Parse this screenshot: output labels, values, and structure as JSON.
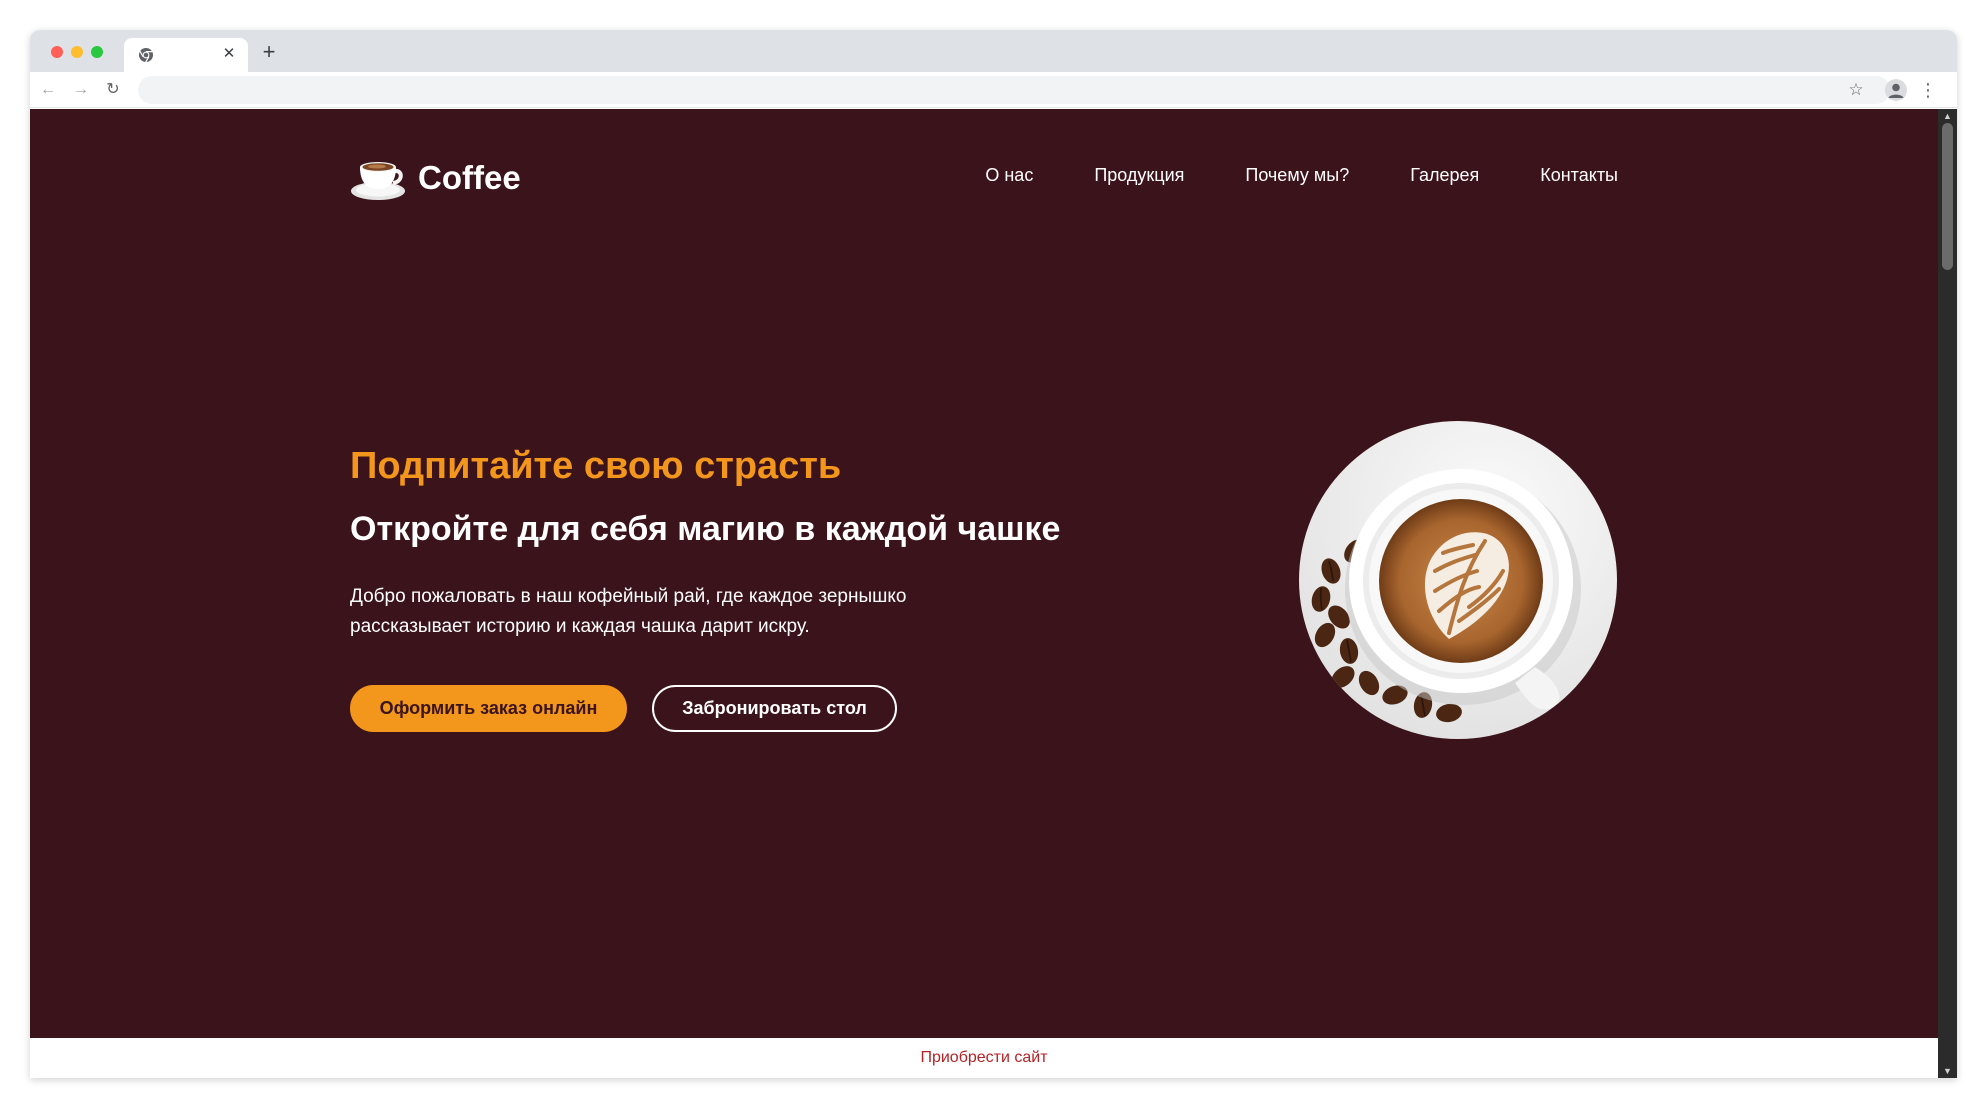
{
  "browser": {
    "tab_title": "",
    "tab_close_glyph": "✕",
    "new_tab_glyph": "+",
    "back_glyph": "←",
    "forward_glyph": "→",
    "reload_glyph": "↻",
    "address_value": "",
    "star_glyph": "☆",
    "menu_glyph": "⋮"
  },
  "header": {
    "logo_text": "Coffee",
    "nav": [
      {
        "label": "О нас"
      },
      {
        "label": "Продукция"
      },
      {
        "label": "Почему мы?"
      },
      {
        "label": "Галерея"
      },
      {
        "label": "Контакты"
      }
    ]
  },
  "hero": {
    "subtitle": "Подпитайте свою страсть",
    "title": "Откройте для себя магию в каждой чашке",
    "description": "Добро пожаловать в наш кофейный рай, где каждое зернышко рассказывает историю и каждая чашка дарит искру.",
    "primary_button": "Оформить заказ онлайн",
    "secondary_button": "Забронировать стол"
  },
  "footer": {
    "link_text": "Приобрести сайт"
  },
  "scrollbar": {
    "up_glyph": "▲",
    "down_glyph": "▼"
  },
  "icons": {
    "tab_favicon": "chrome-icon",
    "logo": "coffee-cup-icon",
    "profile": "person-icon",
    "hero_image": "latte-art-coffee-cup-image"
  },
  "colors": {
    "hero_background": "#3b141b",
    "accent": "#f3961c",
    "footer_link": "#b32226",
    "tabstrip": "#dee1e6"
  }
}
